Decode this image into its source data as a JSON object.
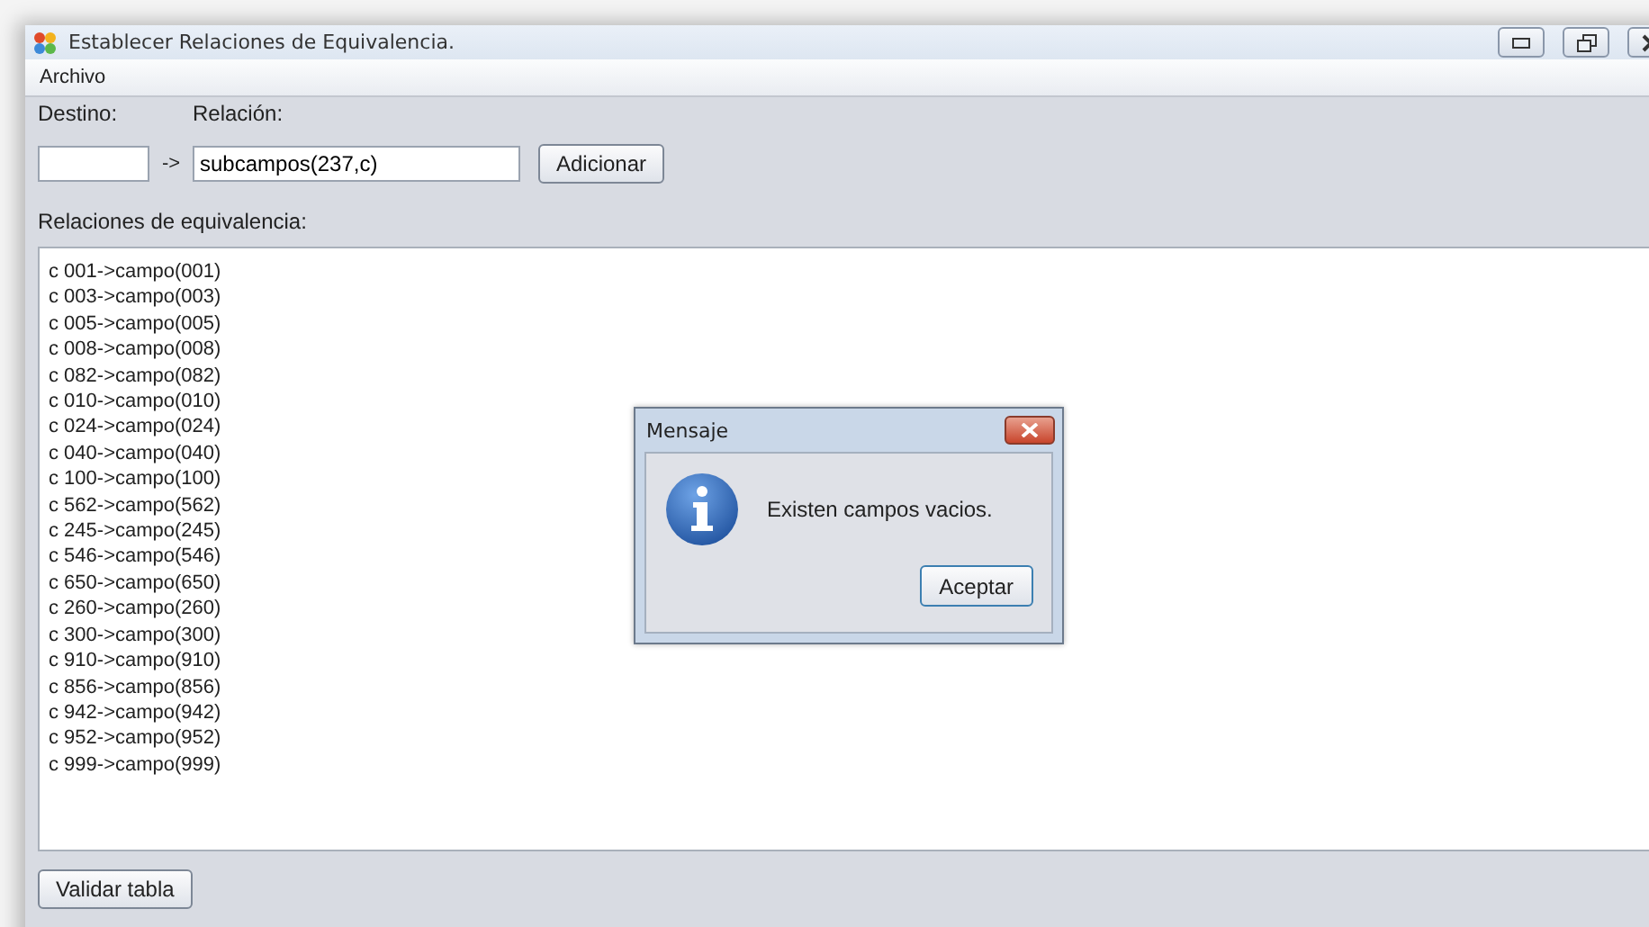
{
  "window": {
    "title": "Establecer Relaciones de Equivalencia."
  },
  "menu": [
    "Archivo"
  ],
  "form": {
    "destino_label": "Destino:",
    "relacion_label": "Relación:",
    "arrow": "->",
    "relacion_value": "subcampos(237,c)",
    "add_button": "Adicionar"
  },
  "relations": {
    "label": "Relaciones de equivalencia:",
    "lines": [
      "c 001->campo(001)",
      "c 003->campo(003)",
      "c 005->campo(005)",
      "c 008->campo(008)",
      "c 082->campo(082)",
      "c 010->campo(010)",
      "c 024->campo(024)",
      "c 040->campo(040)",
      "c 100->campo(100)",
      "c 562->campo(562)",
      "c 245->campo(245)",
      "c 546->campo(546)",
      "c 650->campo(650)",
      "c 260->campo(260)",
      "c 300->campo(300)",
      "c 910->campo(910)",
      "c 856->campo(856)",
      "c 942->campo(942)",
      "c 952->campo(952)",
      "c 999->campo(999)"
    ]
  },
  "validate_button": "Validar tabla",
  "dialog": {
    "title": "Mensaje",
    "message": "Existen campos vacios.",
    "button": "Aceptar"
  }
}
